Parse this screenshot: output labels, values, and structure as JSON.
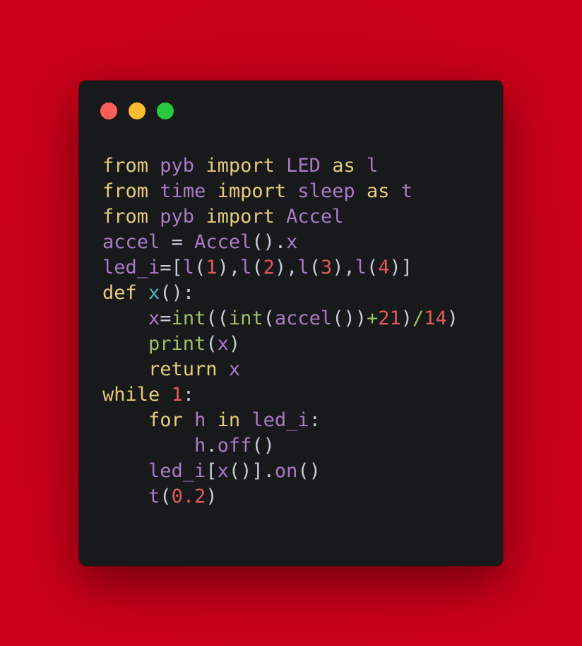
{
  "colors": {
    "background": "#cc0019",
    "window": "#18191b",
    "close_dot": "#ff5f57",
    "minimize_dot": "#febc2e",
    "zoom_dot": "#28c840",
    "keyword": "#e6cc7a",
    "identifier": "#a97ac7",
    "number": "#e05a5a",
    "builtin": "#9cc167",
    "function": "#56b6c2",
    "punctuation": "#c6ccd7"
  },
  "window_controls": [
    {
      "name": "close-dot",
      "color": "#ff5f57"
    },
    {
      "name": "minimize-dot",
      "color": "#febc2e"
    },
    {
      "name": "zoom-dot",
      "color": "#28c840"
    }
  ],
  "code_lines": [
    [
      [
        "kw",
        "from"
      ],
      [
        "p",
        " "
      ],
      [
        "id",
        "pyb"
      ],
      [
        "p",
        " "
      ],
      [
        "kw",
        "import"
      ],
      [
        "p",
        " "
      ],
      [
        "id",
        "LED"
      ],
      [
        "p",
        " "
      ],
      [
        "kw",
        "as"
      ],
      [
        "p",
        " "
      ],
      [
        "id",
        "l"
      ]
    ],
    [
      [
        "kw",
        "from"
      ],
      [
        "p",
        " "
      ],
      [
        "id",
        "time"
      ],
      [
        "p",
        " "
      ],
      [
        "kw",
        "import"
      ],
      [
        "p",
        " "
      ],
      [
        "id",
        "sleep"
      ],
      [
        "p",
        " "
      ],
      [
        "kw",
        "as"
      ],
      [
        "p",
        " "
      ],
      [
        "id",
        "t"
      ]
    ],
    [
      [
        "kw",
        "from"
      ],
      [
        "p",
        " "
      ],
      [
        "id",
        "pyb"
      ],
      [
        "p",
        " "
      ],
      [
        "kw",
        "import"
      ],
      [
        "p",
        " "
      ],
      [
        "id",
        "Accel"
      ]
    ],
    [
      [
        "id",
        "accel"
      ],
      [
        "p",
        " = "
      ],
      [
        "id",
        "Accel"
      ],
      [
        "p",
        "()."
      ],
      [
        "id",
        "x"
      ]
    ],
    [
      [
        "id",
        "led_i"
      ],
      [
        "p",
        "=["
      ],
      [
        "id",
        "l"
      ],
      [
        "p",
        "("
      ],
      [
        "num",
        "1"
      ],
      [
        "p",
        "),"
      ],
      [
        "id",
        "l"
      ],
      [
        "p",
        "("
      ],
      [
        "num",
        "2"
      ],
      [
        "p",
        "),"
      ],
      [
        "id",
        "l"
      ],
      [
        "p",
        "("
      ],
      [
        "num",
        "3"
      ],
      [
        "p",
        "),"
      ],
      [
        "id",
        "l"
      ],
      [
        "p",
        "("
      ],
      [
        "num",
        "4"
      ],
      [
        "p",
        ")]"
      ]
    ],
    [
      [
        "kw",
        "def"
      ],
      [
        "p",
        " "
      ],
      [
        "fn",
        "x"
      ],
      [
        "p",
        "():"
      ]
    ],
    [
      [
        "p",
        "    "
      ],
      [
        "id",
        "x"
      ],
      [
        "p",
        "="
      ],
      [
        "bi",
        "int"
      ],
      [
        "p",
        "(("
      ],
      [
        "bi",
        "int"
      ],
      [
        "p",
        "("
      ],
      [
        "id",
        "accel"
      ],
      [
        "p",
        "())"
      ],
      [
        "bi",
        "+"
      ],
      [
        "num",
        "21"
      ],
      [
        "p",
        ")"
      ],
      [
        "bi",
        "/"
      ],
      [
        "num",
        "14"
      ],
      [
        "p",
        ")"
      ]
    ],
    [
      [
        "p",
        "    "
      ],
      [
        "bi",
        "print"
      ],
      [
        "p",
        "("
      ],
      [
        "id",
        "x"
      ],
      [
        "p",
        ")"
      ]
    ],
    [
      [
        "p",
        "    "
      ],
      [
        "kw",
        "return"
      ],
      [
        "p",
        " "
      ],
      [
        "id",
        "x"
      ]
    ],
    [
      [
        "kw",
        "while"
      ],
      [
        "p",
        " "
      ],
      [
        "num",
        "1"
      ],
      [
        "p",
        ":"
      ]
    ],
    [
      [
        "p",
        "    "
      ],
      [
        "kw",
        "for"
      ],
      [
        "p",
        " "
      ],
      [
        "id",
        "h"
      ],
      [
        "p",
        " "
      ],
      [
        "kw",
        "in"
      ],
      [
        "p",
        " "
      ],
      [
        "id",
        "led_i"
      ],
      [
        "p",
        ":"
      ]
    ],
    [
      [
        "p",
        "        "
      ],
      [
        "id",
        "h"
      ],
      [
        "p",
        "."
      ],
      [
        "id",
        "off"
      ],
      [
        "p",
        "()"
      ]
    ],
    [
      [
        "p",
        "    "
      ],
      [
        "id",
        "led_i"
      ],
      [
        "p",
        "["
      ],
      [
        "id",
        "x"
      ],
      [
        "p",
        "()]."
      ],
      [
        "id",
        "on"
      ],
      [
        "p",
        "()"
      ]
    ],
    [
      [
        "p",
        "    "
      ],
      [
        "id",
        "t"
      ],
      [
        "p",
        "("
      ],
      [
        "num",
        "0.2"
      ],
      [
        "p",
        ")"
      ]
    ]
  ]
}
